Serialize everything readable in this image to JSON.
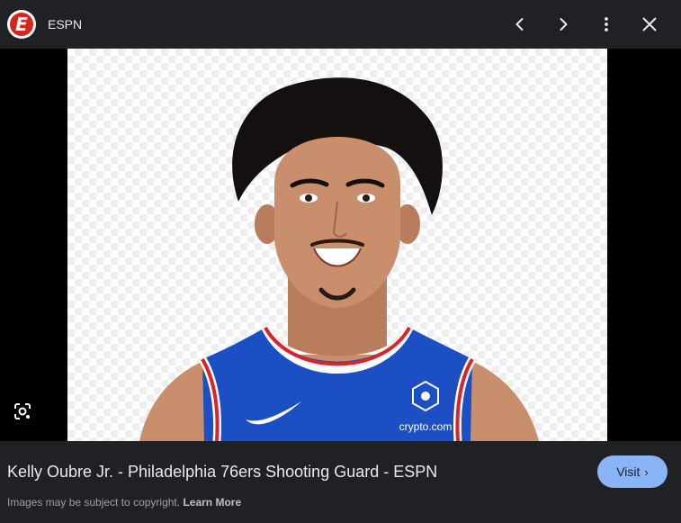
{
  "header": {
    "site_name": "ESPN",
    "logo_letter": "E",
    "buttons": [
      "chevron-left-icon",
      "chevron-right-icon",
      "more-vert-icon",
      "close-icon"
    ]
  },
  "image": {
    "jersey_brand_text": "crypto.com",
    "subject_colors": {
      "jersey": "#1d4fc4",
      "trim_red": "#d9242b",
      "trim_white": "#ffffff",
      "skin": "#c98f6c",
      "hair": "#151010"
    }
  },
  "footer": {
    "caption": "Kelly Oubre Jr. - Philadelphia 76ers Shooting Guard - ESPN",
    "visit_label": "Visit",
    "copyright_text": "Images may be subject to copyright.",
    "learn_more_label": "Learn More"
  },
  "colors": {
    "background": "#202124",
    "accent": "#8ab4f8",
    "text": "#e8eaed",
    "muted": "#9aa0a6"
  }
}
